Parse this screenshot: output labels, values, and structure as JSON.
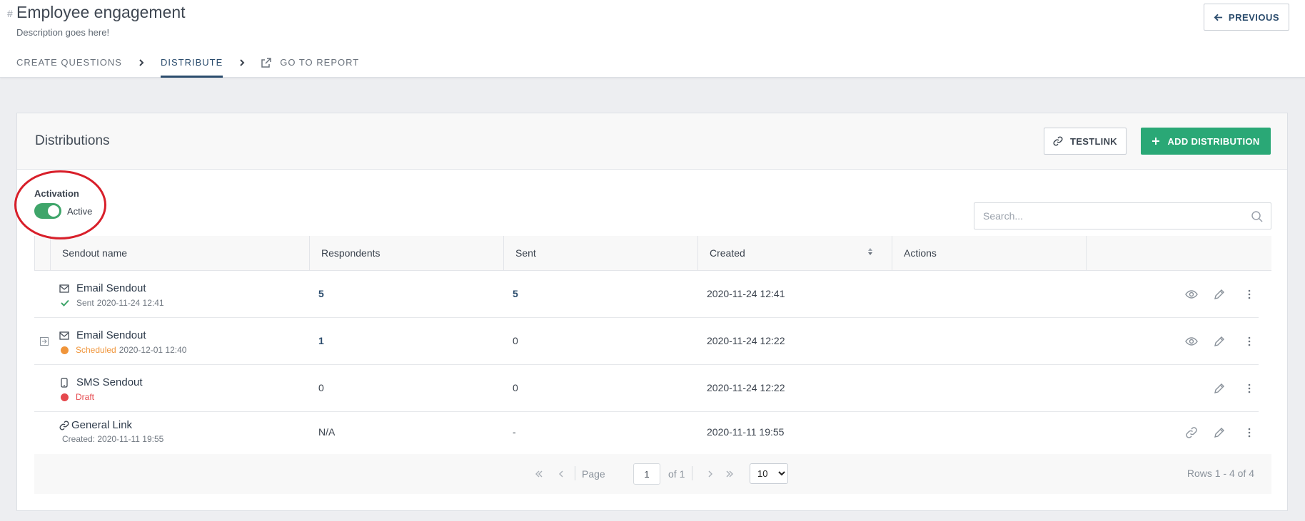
{
  "header": {
    "hash": "#",
    "title": "Employee engagement",
    "description": "Description goes here!",
    "previous_label": "PREVIOUS",
    "steps": [
      {
        "label": "CREATE QUESTIONS"
      },
      {
        "label": "DISTRIBUTE"
      },
      {
        "label": "GO TO REPORT"
      }
    ],
    "active_step": "DISTRIBUTE"
  },
  "card": {
    "title": "Distributions",
    "testlink_label": "TESTLINK",
    "add_label": "ADD DISTRIBUTION",
    "activation": {
      "label": "Activation",
      "state_text": "Active",
      "on": true
    },
    "search": {
      "placeholder": "Search..."
    }
  },
  "table": {
    "columns": [
      "Sendout name",
      "Respondents",
      "Sent",
      "Created",
      "Actions"
    ],
    "sorted_column": "Created",
    "rows": [
      {
        "type_icon": "envelope-icon",
        "name": "Email Sendout",
        "status_icon": "check-icon",
        "status": "Sent",
        "status_date": "2020-11-24 12:41",
        "respondents": "5",
        "sent": "5",
        "created": "2020-11-24 12:41",
        "actions": [
          "eye-icon",
          "pencil-icon",
          "more-vertical-icon"
        ]
      },
      {
        "type_icon": "envelope-icon",
        "expand_icon": "expand-icon",
        "name": "Email Sendout",
        "status": "Scheduled",
        "status_date": "2020-12-01 12:40",
        "respondents": "1",
        "sent": "0",
        "created": "2020-11-24 12:22",
        "actions": [
          "eye-icon",
          "pencil-icon",
          "more-vertical-icon"
        ]
      },
      {
        "type_icon": "mobile-icon",
        "name": "SMS Sendout",
        "status": "Draft",
        "respondents": "0",
        "sent": "0",
        "created": "2020-11-24 12:22",
        "actions": [
          "pencil-icon",
          "more-vertical-icon"
        ]
      },
      {
        "type_icon": "link-icon",
        "name": "General Link",
        "status": "Created: 2020-11-11 19:55",
        "respondents": "N/A",
        "sent": "-",
        "created": "2020-11-11 19:55",
        "actions": [
          "link-icon",
          "pencil-icon",
          "more-vertical-icon"
        ]
      }
    ]
  },
  "pagination": {
    "page_label": "Page",
    "page": "1",
    "of_label": "of 1",
    "rows_per_page": "10",
    "rows_options": [
      "10"
    ],
    "rows_info": "Rows 1 - 4 of 4"
  },
  "colors": {
    "primary": "#2b4c6d",
    "accent_green": "#2aa876",
    "toggle_green": "#3fa56a",
    "sent_check": "#3fa56a",
    "scheduled": "#f0953a",
    "draft": "#e5484d",
    "annotation_circle": "#d81f2a"
  }
}
